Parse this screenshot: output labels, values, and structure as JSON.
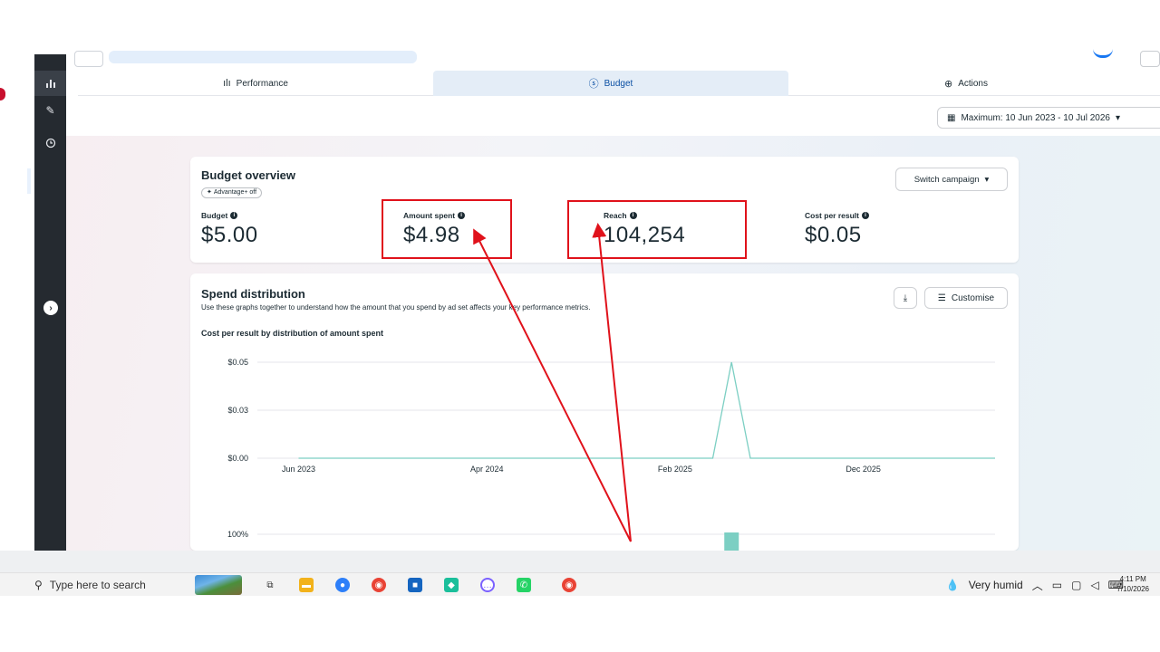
{
  "tabs": {
    "performance": "Performance",
    "budget": "Budget",
    "actions": "Actions"
  },
  "date_range": "Maximum: 10 Jun 2023 - 10 Jul 2026",
  "budget_overview": {
    "title": "Budget overview",
    "chip": "Advantage+ off",
    "switch_label": "Switch campaign",
    "metrics": [
      {
        "label": "Budget",
        "value": "$5.00"
      },
      {
        "label": "Amount spent",
        "value": "$4.98"
      },
      {
        "label": "Reach",
        "value": "104,254"
      },
      {
        "label": "Cost per result",
        "value": "$0.05"
      }
    ]
  },
  "spend_distribution": {
    "title": "Spend distribution",
    "subtitle": "Use these graphs together to understand how the amount that you spend by ad set affects your key performance metrics.",
    "customise_label": "Customise",
    "chart_title": "Cost per result by distribution of amount spent"
  },
  "chart_data": [
    {
      "type": "line",
      "title": "Cost per result by distribution of amount spent",
      "y_ticks": [
        "$0.05",
        "$0.03",
        "$0.00"
      ],
      "x_ticks": [
        "Jun 2023",
        "Apr 2024",
        "Feb 2025",
        "Dec 2025"
      ],
      "ylim": [
        0,
        0.05
      ],
      "x": [
        "Jun 2023",
        "Apr 2024",
        "Feb 2025",
        "Apr 2025",
        "May 2025",
        "Jun 2025",
        "Dec 2025",
        "Jul 2026"
      ],
      "series": [
        {
          "values": [
            0,
            0,
            0,
            0,
            0.05,
            0,
            0,
            0
          ]
        }
      ],
      "color": "#7ccfc3",
      "grid": true
    },
    {
      "type": "bar",
      "y_ticks": [
        "100%"
      ],
      "x": [
        "May 2025"
      ],
      "values": [
        100
      ],
      "color": "#7ccfc3",
      "grid": true
    }
  ],
  "taskbar": {
    "search_placeholder": "Type here to search",
    "weather": "Very humid",
    "time": "4:11 PM",
    "date": "7/10/2026"
  },
  "colors": {
    "annotation": "#e0121b",
    "rail": "#252a30",
    "selected_tab": "#e4edf7",
    "series": "#7ccfc3"
  }
}
